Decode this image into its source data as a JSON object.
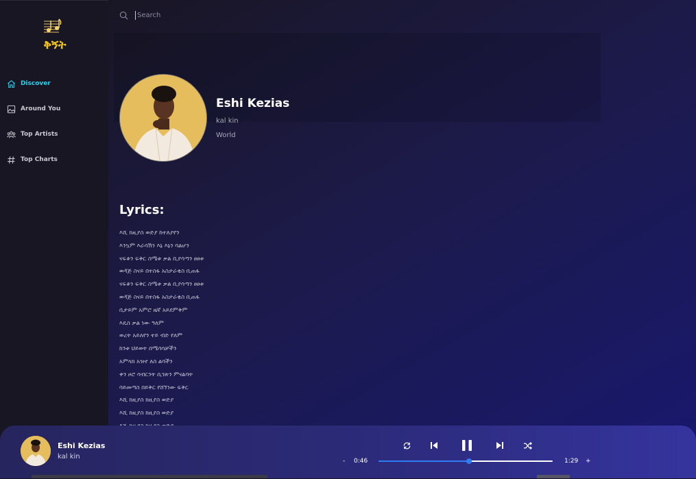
{
  "app": {
    "logo_text": "ቅኝት",
    "accent_color": "#22d3ee"
  },
  "sidebar": {
    "items": [
      {
        "label": "Discover",
        "icon": "home-icon",
        "active": true
      },
      {
        "label": "Around You",
        "icon": "image-icon",
        "active": false
      },
      {
        "label": "Top Artists",
        "icon": "users-icon",
        "active": false
      },
      {
        "label": "Top Charts",
        "icon": "hashtag-icon",
        "active": false
      }
    ]
  },
  "search": {
    "placeholder": "Search",
    "value": ""
  },
  "song": {
    "title": "Eshi Kezias",
    "artist": "kal kin",
    "genre": "World",
    "image": "artist-photo"
  },
  "lyrics": {
    "heading": "Lyrics:",
    "lines": [
      "እሺ ክዚያስ ወድያ ከተለያየን",
      "እንኳም እራሳሽን እኔ እኔን ባልሆን",
      "ናፍቆን ፍቅር ስሜቱ ቃል ቢያሳጣን ፀፀቱ",
      "ወዳጅ ስናይ በተስፋ አስታራቂስ ቢጠፋ",
      "ናፍቆን ፍቅር ስሜቱ ቃል ቢያሳጣን ፀፀቱ",
      "ወዳጅ ስናይ በተስፋ አስታራቂስ ቢጠፋ",
      "ቢታይም አምሮ ዜኛ አይደምቅም",
      "እዴስ ቃል ነው ዓለም",
      "ወረት አይለየን ተይ ብድ የለም",
      "ከንቱ ህይወት በሜሳሳቻችን",
      "አምላክ አዝኖ ለስ ልባችን",
      "ቀን ዞሮ ሳብርንት ሲገጽን ምናልባት",
      "ባይመጣስ በይቅር የሸኘነው ፍቅር",
      "እሺ ክዚያስ ክዚያስ ወድያ",
      "እሺ ክዚያስ ክዚያስ ወድያ",
      "እሺ ክዚያስ ክዚያስ ወድያ"
    ]
  },
  "player": {
    "title": "Eshi Kezias",
    "artist": "kal kin",
    "minus_label": "-",
    "current_time": "0:46",
    "duration": "1:29",
    "plus_label": "+",
    "progress_fraction": 0.52,
    "state": "playing",
    "accent_color": "#2f7cf6",
    "controls": [
      "repeat-icon",
      "previous-icon",
      "pause-icon",
      "next-icon",
      "shuffle-icon"
    ]
  }
}
